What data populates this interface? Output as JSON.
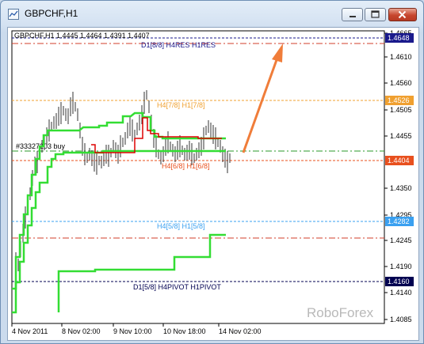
{
  "window": {
    "title": "GBPCHF,H1"
  },
  "header": {
    "ohlc": "GBPCHF,H1  1.4445 1.4464 1.4391 1.4407"
  },
  "price_axis": {
    "ticks": [
      "1.4665",
      "1.4610",
      "1.4560",
      "1.4505",
      "1.4455",
      "1.4350",
      "1.4295",
      "1.4245",
      "1.4190",
      "1.4140",
      "1.4085"
    ]
  },
  "time_axis": {
    "ticks": [
      "4 Nov 2011",
      "8 Nov 02:00",
      "9 Nov 10:00",
      "10 Nov 18:00",
      "14 Nov 02:00"
    ]
  },
  "levels": [
    {
      "label": "D1[8/8] H4RES H1RES",
      "price_tag": "1.4648",
      "color": "#1a1a8c",
      "tag_fg": "#ffffff"
    },
    {
      "label": "H4[7/8] H1[7/8]",
      "price_tag": "1.4526",
      "color": "#f0a030",
      "tag_fg": "#ffffff"
    },
    {
      "label": "H4[6/8] H1[6/8]",
      "price_tag": "1.4404",
      "color": "#e8501e",
      "tag_fg": "#ffffff"
    },
    {
      "label": "H4[5/8] H1[5/8]",
      "price_tag": "1.4282",
      "color": "#3aa0f0",
      "tag_fg": "#ffffff"
    },
    {
      "label": "D1[5/8] H4PIVOT H1PIVOT",
      "price_tag": "1.4160",
      "color": "#000050",
      "tag_fg": "#ffffff"
    }
  ],
  "order_label": "#33327203 buy",
  "watermark": "RoboForex",
  "colors": {
    "bullish_line": "#33dd33",
    "stop_line": "#dd0000",
    "arrow": "#f07d3a",
    "candles": "#333333"
  }
}
